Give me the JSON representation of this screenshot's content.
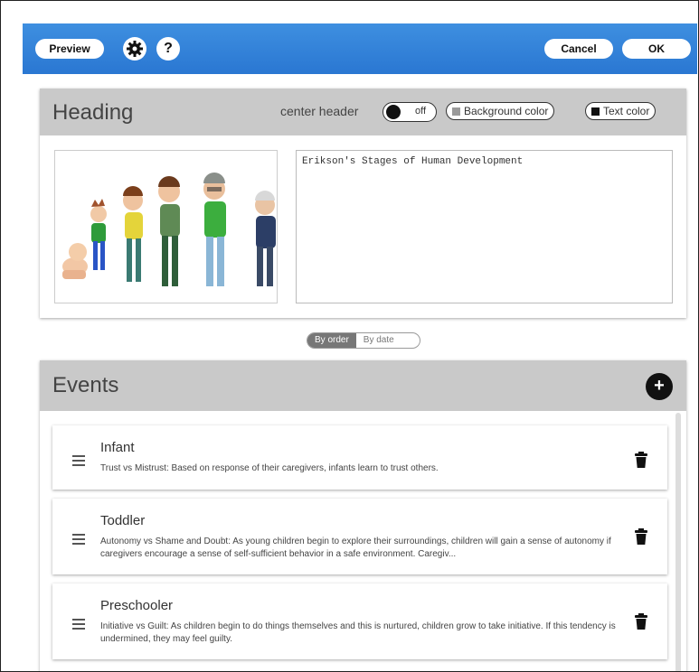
{
  "toolbar": {
    "preview_label": "Preview",
    "settings_icon": "gear-icon",
    "help_label": "?",
    "cancel_label": "Cancel",
    "ok_label": "OK"
  },
  "heading": {
    "title": "Heading",
    "center_header_label": "center header",
    "toggle_state": "off",
    "background_color_label": "Background color",
    "text_color_label": "Text color",
    "background_swatch": "#9a9a9a",
    "text_swatch": "#111111",
    "title_value": "Erikson's Stages of Human Development"
  },
  "sort": {
    "by_order": "By order",
    "by_date": "By date"
  },
  "events": {
    "title": "Events",
    "items": [
      {
        "title": "Infant",
        "desc": "Trust vs Mistrust: Based on response of their caregivers, infants learn to trust others."
      },
      {
        "title": "Toddler",
        "desc": "Autonomy vs Shame and Doubt: As young children begin to explore their surroundings, children will gain a sense of autonomy if caregivers encourage a sense of self-sufficient behavior in a safe environment. Caregiv..."
      },
      {
        "title": "Preschooler",
        "desc": "Initiative vs Guilt: As children begin to do things themselves and this is nurtured, children grow to take initiative. If this tendency is undermined, they may feel guilty."
      }
    ]
  },
  "colors": {
    "toolbar_blue": "#2f7fd8",
    "panel_header_gray": "#c9c9c9"
  }
}
